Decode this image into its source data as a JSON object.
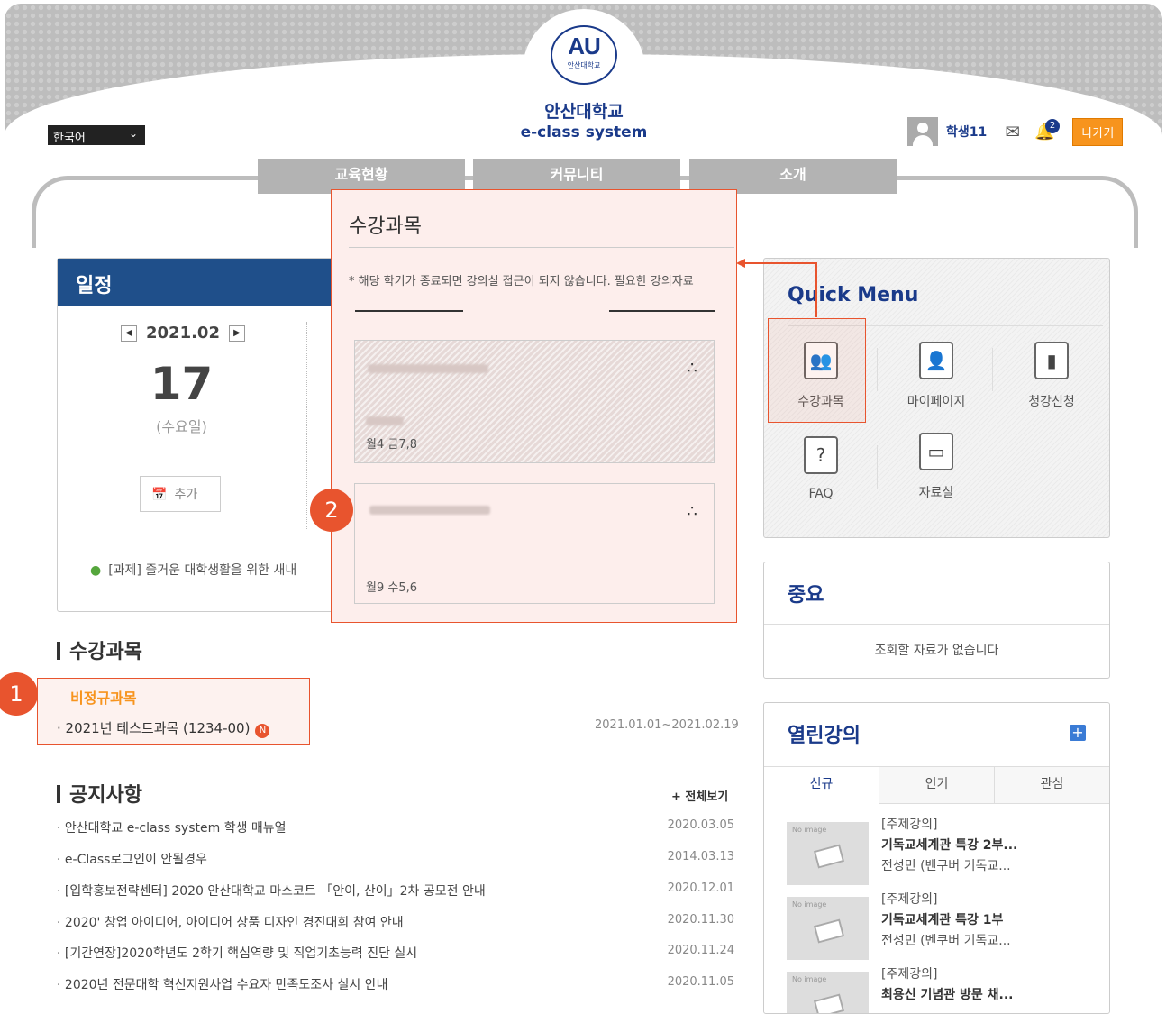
{
  "header": {
    "logo_mark": "AU",
    "logo_sub": "안산대학교",
    "university": "안산대학교",
    "system_name": "e-class system",
    "language": "한국어",
    "user_name": "학생11",
    "notification_count": "2",
    "logout_label": "나가기"
  },
  "nav": [
    "교육현황",
    "커뮤니티",
    "소개"
  ],
  "schedule": {
    "title": "일정",
    "month": "2021.02",
    "day": "17",
    "weekday": "(수요일)",
    "add_label": "추가",
    "task": "[과제] 즐거운 대학생활을 위한 새내"
  },
  "popup": {
    "title": "수강과목",
    "notice": "* 해당 학기가 종료되면 강의실 접근이 되지 않습니다. 필요한 강의자료",
    "card1_schedule": "월4 금7,8",
    "card2_schedule": "월9 수5,6"
  },
  "markers": [
    "1",
    "2"
  ],
  "quick_menu": {
    "title": "Quick Menu",
    "items": [
      "수강과목",
      "마이페이지",
      "청강신청",
      "FAQ",
      "자료실"
    ]
  },
  "important": {
    "title": "중요",
    "empty": "조회할 자료가 없습니다"
  },
  "open_lectures": {
    "title": "열린강의",
    "tabs": [
      "신규",
      "인기",
      "관심"
    ],
    "no_image": "No image",
    "items": [
      {
        "cat": "[주제강의]",
        "title": "기독교세계관 특강 2부...",
        "author": "전성민 (벤쿠버 기독교..."
      },
      {
        "cat": "[주제강의]",
        "title": "기독교세계관 특강 1부",
        "author": "전성민 (벤쿠버 기독교..."
      },
      {
        "cat": "[주제강의]",
        "title": "최용신 기념관 방문 채...",
        "author": ""
      }
    ]
  },
  "courses": {
    "title": "수강과목",
    "category": "비정규과목",
    "course_name": "2021년 테스트과목 (1234-00)",
    "new_badge": "N",
    "period": "2021.01.01~2021.02.19"
  },
  "notices": {
    "title": "공지사항",
    "more": "+ 전체보기",
    "items": [
      {
        "title": "안산대학교 e-class system 학생 매뉴얼",
        "date": "2020.03.05"
      },
      {
        "title": "e-Class로그인이 안될경우",
        "date": "2014.03.13"
      },
      {
        "title": "[입학홍보전략센터] 2020 안산대학교 마스코트 「안이, 산이」2차 공모전 안내",
        "date": "2020.12.01"
      },
      {
        "title": "2020' 창업 아이디어, 아이디어 상품 디자인 경진대회 참여 안내",
        "date": "2020.11.30"
      },
      {
        "title": "[기간연장]2020학년도 2학기 핵심역량 및 직업기초능력 진단 실시",
        "date": "2020.11.24"
      },
      {
        "title": "2020년 전문대학 혁신지원사업 수요자 만족도조사 실시 안내",
        "date": "2020.11.05"
      }
    ]
  }
}
